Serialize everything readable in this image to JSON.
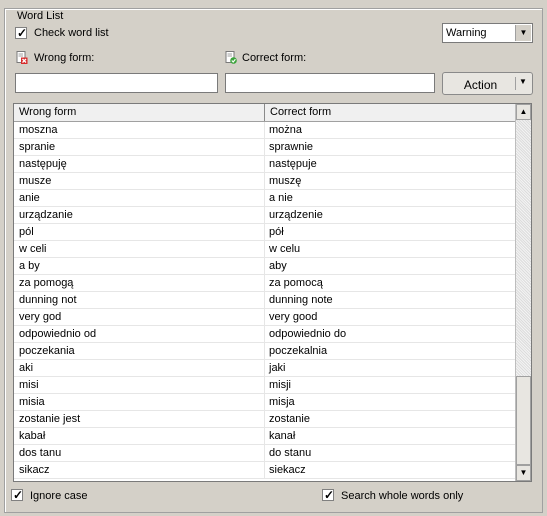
{
  "group_title": "Word List",
  "check_word_list": {
    "label": "Check word list",
    "checked": true
  },
  "severity": {
    "selected": "Warning"
  },
  "wrong_form": {
    "label": "Wrong form:",
    "value": ""
  },
  "correct_form": {
    "label": "Correct form:",
    "value": ""
  },
  "action_button": {
    "label": "Action"
  },
  "table": {
    "columns": [
      "Wrong form",
      "Correct form"
    ],
    "rows": [
      [
        "moszna",
        "można"
      ],
      [
        "spranie",
        "sprawnie"
      ],
      [
        "następuję",
        "następuje"
      ],
      [
        "musze",
        "muszę"
      ],
      [
        "anie",
        "a nie"
      ],
      [
        "urządzanie",
        "urządzenie"
      ],
      [
        "pól",
        "pół"
      ],
      [
        "w celi",
        "w celu"
      ],
      [
        "a by",
        "aby"
      ],
      [
        "za pomogą",
        "za pomocą"
      ],
      [
        "dunning not",
        "dunning note"
      ],
      [
        "very god",
        "very good"
      ],
      [
        "odpowiednio od",
        "odpowiednio do"
      ],
      [
        "poczekania",
        "poczekalnia"
      ],
      [
        "aki",
        "jaki"
      ],
      [
        "misi",
        "misji"
      ],
      [
        "misia",
        "misja"
      ],
      [
        "zostanie jest",
        "zostanie"
      ],
      [
        "kabał",
        "kanał"
      ],
      [
        "dos tanu",
        "do stanu"
      ],
      [
        "sikacz",
        "siekacz"
      ]
    ]
  },
  "ignore_case": {
    "label": "Ignore case",
    "checked": true
  },
  "whole_words": {
    "label": "Search whole words only",
    "checked": true
  },
  "icons": {
    "wrong_form_icon": "document-red-x-icon",
    "correct_form_icon": "document-green-check-icon"
  }
}
